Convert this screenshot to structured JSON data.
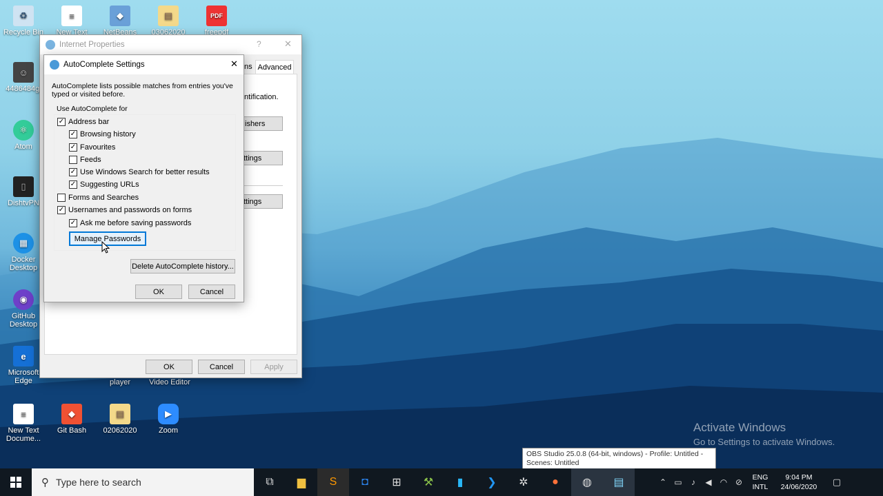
{
  "colors": {
    "accent": "#0078d7",
    "taskbar": "#101820",
    "dialog_bg": "#f0f0f0"
  },
  "desktop_icons": [
    {
      "label": "Recycle Bin",
      "icon": "recycle-bin-icon"
    },
    {
      "label": "New Text",
      "icon": "text-file-icon"
    },
    {
      "label": "NetBeans IDE",
      "icon": "netbeans-icon"
    },
    {
      "label": "03062020",
      "icon": "zip-folder-icon"
    },
    {
      "label": "freepdf",
      "icon": "pdf-icon"
    },
    {
      "label": "4486484gj",
      "icon": "photo-icon"
    },
    {
      "label": "Atom",
      "icon": "atom-icon"
    },
    {
      "label": "DishtvPN",
      "icon": "phone-icon"
    },
    {
      "label": "Docker Desktop",
      "icon": "docker-icon"
    },
    {
      "label": "GitHub Desktop",
      "icon": "github-icon"
    },
    {
      "label": "Microsoft Edge",
      "icon": "edge-icon"
    },
    {
      "label": "player",
      "icon": "player-icon"
    },
    {
      "label": "Video Editor",
      "icon": "video-editor-icon"
    },
    {
      "label": "New Text Docume...",
      "icon": "text-file-icon"
    },
    {
      "label": "Git Bash",
      "icon": "git-bash-icon"
    },
    {
      "label": "02062020",
      "icon": "zip-folder-icon"
    },
    {
      "label": "Zoom",
      "icon": "zoom-icon"
    }
  ],
  "internet_properties": {
    "title": "Internet Properties",
    "help": "?",
    "close": "✕",
    "tab_partial": "ns",
    "tab_advanced": "Advanced",
    "text_fragment": "ntification.",
    "btn_publishers": "ishers",
    "btn_settings1": "ttings",
    "btn_settings2": "ttings",
    "ok": "OK",
    "cancel": "Cancel",
    "apply": "Apply"
  },
  "autocomplete": {
    "title": "AutoComplete Settings",
    "close": "✕",
    "description": "AutoComplete lists possible matches from entries you've typed or visited before.",
    "group_label": "Use AutoComplete for",
    "options": {
      "address_bar": "Address bar",
      "browsing_history": "Browsing history",
      "favourites": "Favourites",
      "feeds": "Feeds",
      "windows_search": "Use Windows Search for better results",
      "suggesting_urls": "Suggesting URLs",
      "forms": "Forms and Searches",
      "usernames": "Usernames and passwords on forms",
      "ask_saving": "Ask me before saving passwords"
    },
    "manage_passwords": "Manage Passwords",
    "delete_history": "Delete AutoComplete history...",
    "ok": "OK",
    "cancel": "Cancel"
  },
  "watermark": {
    "title": "Activate Windows",
    "subtitle": "Go to Settings to activate Windows."
  },
  "tooltip": {
    "line1": "OBS Studio 25.0.8 (64-bit, windows) - Profile: Untitled -",
    "line2": "Scenes: Untitled"
  },
  "taskbar": {
    "search_placeholder": "Type here to search",
    "lang_top": "ENG",
    "lang_bottom": "INTL",
    "time": "9:04 PM",
    "date": "24/06/2020"
  }
}
